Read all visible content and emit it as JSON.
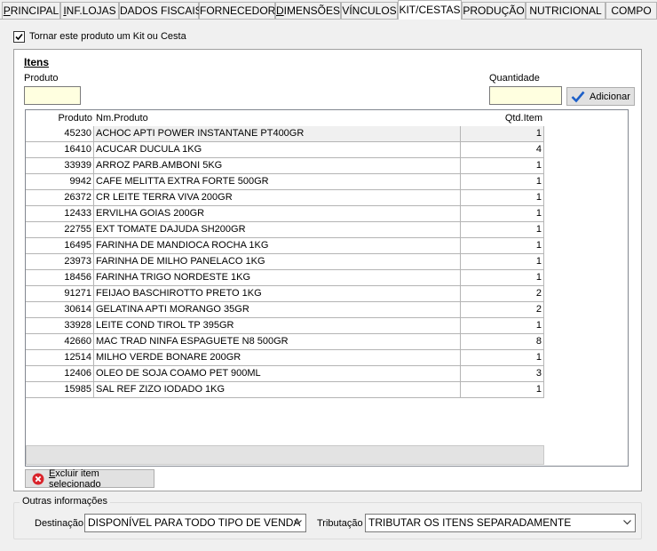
{
  "tabs": [
    {
      "label": "PRINCIPAL",
      "mnemonic": "P",
      "rest": "RINCIPAL"
    },
    {
      "label": "INF.LOJAS",
      "mnemonic": "I",
      "rest": "NF.LOJAS"
    },
    {
      "label": "DADOS FISCAIS",
      "mnemonic": "",
      "rest": "DADOS FISCAIS"
    },
    {
      "label": "FORNECEDOR",
      "mnemonic": "",
      "rest": "FORNECEDOR"
    },
    {
      "label": "DIMENSÕES",
      "mnemonic": "D",
      "rest": "IMENSÕES"
    },
    {
      "label": "VÍNCULOS",
      "mnemonic": "",
      "rest": "VÍNCULOS"
    },
    {
      "label": "KIT/CESTAS",
      "mnemonic": "",
      "rest": "KIT/CESTAS"
    },
    {
      "label": "PRODUÇÃO",
      "mnemonic": "",
      "rest": "PRODUÇÃO"
    },
    {
      "label": "NUTRICIONAL",
      "mnemonic": "",
      "rest": "NUTRICIONAL"
    },
    {
      "label": "COMPO",
      "mnemonic": "",
      "rest": "COMPO"
    }
  ],
  "active_tab": "KIT/CESTAS",
  "kit_checkbox": {
    "label": "Tornar este produto um Kit ou Cesta",
    "checked": true
  },
  "items": {
    "title": "Itens",
    "produto_label": "Produto",
    "quantidade_label": "Quantidade",
    "produto_value": "",
    "quantidade_value": "",
    "add_button": "Adicionar",
    "delete_button": "Excluir item selecionado",
    "columns": [
      "Produto",
      "Nm.Produto",
      "Qtd.Item"
    ],
    "rows": [
      {
        "code": "45230",
        "name": "ACHOC APTI POWER INSTANTANE PT400GR",
        "qty": "1"
      },
      {
        "code": "16410",
        "name": "ACUCAR DUCULA 1KG",
        "qty": "4"
      },
      {
        "code": "33939",
        "name": "ARROZ PARB.AMBONI 5KG",
        "qty": "1"
      },
      {
        "code": "9942",
        "name": "CAFE MELITTA EXTRA FORTE 500GR",
        "qty": "1"
      },
      {
        "code": "26372",
        "name": "CR LEITE TERRA VIVA 200GR",
        "qty": "1"
      },
      {
        "code": "12433",
        "name": "ERVILHA GOIAS 200GR",
        "qty": "1"
      },
      {
        "code": "22755",
        "name": "EXT TOMATE DAJUDA SH200GR",
        "qty": "1"
      },
      {
        "code": "16495",
        "name": "FARINHA DE MANDIOCA ROCHA 1KG",
        "qty": "1"
      },
      {
        "code": "23973",
        "name": "FARINHA DE MILHO PANELACO 1KG",
        "qty": "1"
      },
      {
        "code": "18456",
        "name": "FARINHA TRIGO NORDESTE 1KG",
        "qty": "1"
      },
      {
        "code": "91271",
        "name": "FEIJAO BASCHIROTTO PRETO 1KG",
        "qty": "2"
      },
      {
        "code": "30614",
        "name": "GELATINA APTI MORANGO 35GR",
        "qty": "2"
      },
      {
        "code": "33928",
        "name": "LEITE COND TIROL TP 395GR",
        "qty": "1"
      },
      {
        "code": "42660",
        "name": "MAC TRAD NINFA ESPAGUETE N8 500GR",
        "qty": "8"
      },
      {
        "code": "12514",
        "name": "MILHO VERDE BONARE 200GR",
        "qty": "1"
      },
      {
        "code": "12406",
        "name": "OLEO DE SOJA COAMO PET 900ML",
        "qty": "3"
      },
      {
        "code": "15985",
        "name": "SAL REF ZIZO IODADO 1KG",
        "qty": "1"
      }
    ]
  },
  "outras": {
    "title": "Outras informações",
    "destinacao_label": "Destinação",
    "destinacao_value": "DISPONÍVEL PARA TODO TIPO DE VENDA",
    "tributacao_label": "Tributação",
    "tributacao_value": "TRIBUTAR OS ITENS SEPARADAMENTE"
  },
  "colors": {
    "field_bg": "#ffffe0",
    "check_blue": "#1c5fc8",
    "delete_red": "#d9242b"
  }
}
